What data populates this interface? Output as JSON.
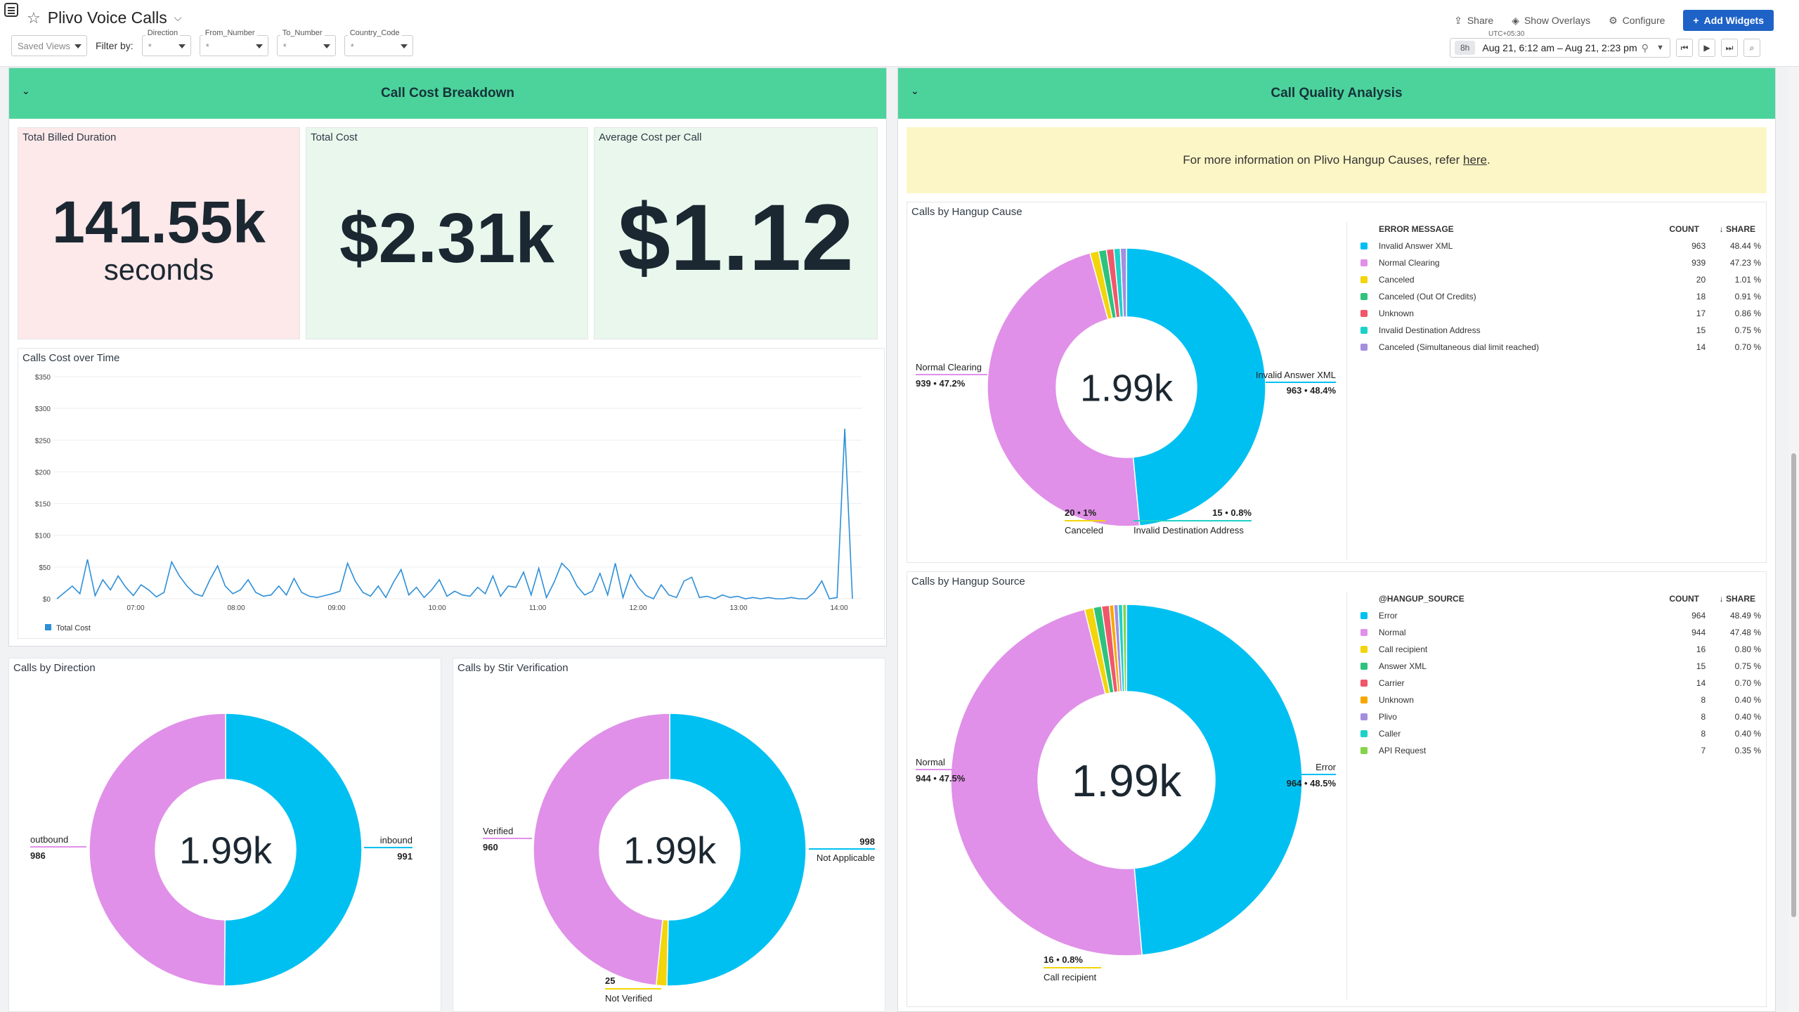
{
  "header": {
    "title": "Plivo Voice Calls",
    "saved_views": "Saved Views",
    "filter_by": "Filter by:",
    "filters": [
      {
        "label": "Direction",
        "value": "*"
      },
      {
        "label": "From_Number",
        "value": "*"
      },
      {
        "label": "To_Number",
        "value": "*"
      },
      {
        "label": "Country_Code",
        "value": "*"
      }
    ],
    "actions": {
      "share": "Share",
      "overlays": "Show Overlays",
      "configure": "Configure",
      "add_widgets": "Add Widgets"
    },
    "time": {
      "tz": "UTC+05:30",
      "span": "8h",
      "range": "Aug 21, 6:12 am – Aug 21, 2:23 pm"
    }
  },
  "cost_group": {
    "title": "Call Cost Breakdown",
    "kpis": [
      {
        "title": "Total Billed Duration",
        "value": "141.55k",
        "unit": "seconds",
        "bg": "#fde8ea"
      },
      {
        "title": "Total Cost",
        "value": "$2.31k",
        "unit": "",
        "bg": "#e9f7ed"
      },
      {
        "title": "Average Cost per Call",
        "value": "$1.12",
        "unit": "",
        "bg": "#e9f7ed"
      }
    ],
    "timeseries": {
      "title": "Calls Cost over Time",
      "legend": "Total Cost",
      "color": "#2d8fd8"
    }
  },
  "quality_group": {
    "title": "Call Quality Analysis",
    "banner_text": "For more information on Plivo Hangup Causes, refer",
    "banner_link": "here",
    "hangup_cause": {
      "title": "Calls by Hangup Cause",
      "center": "1.99k",
      "col_name": "ERROR MESSAGE",
      "col_count": "COUNT",
      "col_share": "SHARE",
      "label_left": "Normal Clearing",
      "label_left_val": "939 • 47.2%",
      "label_right": "Invalid Answer XML",
      "label_right_val": "963 • 48.4%",
      "label_b1_val": "20 • 1%",
      "label_b1": "Canceled",
      "label_b2_val": "15 • 0.8%",
      "label_b2": "Invalid Destination Address",
      "rows": [
        {
          "name": "Invalid Answer XML",
          "count": "963",
          "share": "48.44 %",
          "color": "#00c0f2"
        },
        {
          "name": "Normal Clearing",
          "count": "939",
          "share": "47.23 %",
          "color": "#e090e8"
        },
        {
          "name": "Canceled",
          "count": "20",
          "share": "1.01 %",
          "color": "#f2d50a"
        },
        {
          "name": "Canceled (Out Of Credits)",
          "count": "18",
          "share": "0.91 %",
          "color": "#2ec27e"
        },
        {
          "name": "Unknown",
          "count": "17",
          "share": "0.86 %",
          "color": "#f0576a"
        },
        {
          "name": "Invalid Destination Address",
          "count": "15",
          "share": "0.75 %",
          "color": "#1ed1c8"
        },
        {
          "name": "Canceled (Simultaneous dial limit reached)",
          "count": "14",
          "share": "0.70 %",
          "color": "#a58ee0"
        }
      ]
    },
    "hangup_source": {
      "title": "Calls by Hangup Source",
      "center": "1.99k",
      "col_name": "@HANGUP_SOURCE",
      "col_count": "COUNT",
      "col_share": "SHARE",
      "label_left": "Normal",
      "label_left_val": "944 • 47.5%",
      "label_right": "Error",
      "label_right_val": "964 • 48.5%",
      "label_b1_val": "16 • 0.8%",
      "label_b1": "Call recipient",
      "rows": [
        {
          "name": "Error",
          "count": "964",
          "share": "48.49 %",
          "color": "#00c0f2"
        },
        {
          "name": "Normal",
          "count": "944",
          "share": "47.48 %",
          "color": "#e090e8"
        },
        {
          "name": "Call recipient",
          "count": "16",
          "share": "0.80 %",
          "color": "#f2d50a"
        },
        {
          "name": "Answer XML",
          "count": "15",
          "share": "0.75 %",
          "color": "#2ec27e"
        },
        {
          "name": "Carrier",
          "count": "14",
          "share": "0.70 %",
          "color": "#f0576a"
        },
        {
          "name": "Unknown",
          "count": "8",
          "share": "0.40 %",
          "color": "#f7a800"
        },
        {
          "name": "Plivo",
          "count": "8",
          "share": "0.40 %",
          "color": "#a58ee0"
        },
        {
          "name": "Caller",
          "count": "8",
          "share": "0.40 %",
          "color": "#1ed1c8"
        },
        {
          "name": "API Request",
          "count": "7",
          "share": "0.35 %",
          "color": "#86d34a"
        }
      ]
    }
  },
  "direction": {
    "title": "Calls by Direction",
    "center": "1.99k",
    "label_left": "outbound",
    "label_left_val": "986",
    "label_right": "inbound",
    "label_right_val": "991"
  },
  "stir": {
    "title": "Calls by Stir Verification",
    "center": "1.99k",
    "label_left": "Verified",
    "label_left_val": "960",
    "label_right": "Not Applicable",
    "label_right_val": "998",
    "label_b1_val": "25",
    "label_b1": "Not Verified"
  },
  "chart_data": [
    {
      "type": "line",
      "title": "Calls Cost over Time",
      "series": [
        {
          "name": "Total Cost",
          "values": [
            0,
            10,
            20,
            8,
            62,
            5,
            30,
            14,
            36,
            18,
            5,
            22,
            14,
            3,
            10,
            58,
            36,
            20,
            8,
            4,
            30,
            52,
            20,
            8,
            14,
            30,
            10,
            4,
            6,
            20,
            6,
            32,
            10,
            4,
            2,
            5,
            8,
            12,
            56,
            28,
            10,
            4,
            20,
            2,
            26,
            46,
            6,
            18,
            2,
            14,
            30,
            4,
            12,
            6,
            4,
            18,
            8,
            36,
            4,
            20,
            18,
            42,
            6,
            48,
            2,
            26,
            56,
            44,
            20,
            6,
            12,
            40,
            6,
            56,
            2,
            38,
            18,
            5,
            0,
            22,
            6,
            2,
            28,
            34,
            2,
            4,
            0,
            6,
            2,
            4,
            0,
            2,
            0,
            2,
            0,
            0,
            2,
            0,
            0,
            10,
            28,
            0,
            2,
            268,
            0
          ]
        }
      ],
      "x_ticks": [
        "07:00",
        "08:00",
        "09:00",
        "10:00",
        "11:00",
        "12:00",
        "13:00",
        "14:00"
      ],
      "y_ticks": [
        "$0",
        "$50",
        "$100",
        "$150",
        "$200",
        "$250",
        "$300",
        "$350"
      ],
      "ylim": [
        0,
        350
      ]
    },
    {
      "type": "pie",
      "title": "Calls by Hangup Cause",
      "labels": [
        "Invalid Answer XML",
        "Normal Clearing",
        "Canceled",
        "Canceled (Out Of Credits)",
        "Unknown",
        "Invalid Destination Address",
        "Canceled (Simultaneous dial limit reached)"
      ],
      "values": [
        963,
        939,
        20,
        18,
        17,
        15,
        14
      ]
    },
    {
      "type": "pie",
      "title": "Calls by Hangup Source",
      "labels": [
        "Error",
        "Normal",
        "Call recipient",
        "Answer XML",
        "Carrier",
        "Unknown",
        "Plivo",
        "Caller",
        "API Request"
      ],
      "values": [
        964,
        944,
        16,
        15,
        14,
        8,
        8,
        8,
        7
      ]
    },
    {
      "type": "pie",
      "title": "Calls by Direction",
      "labels": [
        "inbound",
        "outbound"
      ],
      "values": [
        991,
        986
      ]
    },
    {
      "type": "pie",
      "title": "Calls by Stir Verification",
      "labels": [
        "Not Applicable",
        "Not Verified",
        "Verified"
      ],
      "values": [
        998,
        25,
        960
      ]
    }
  ]
}
